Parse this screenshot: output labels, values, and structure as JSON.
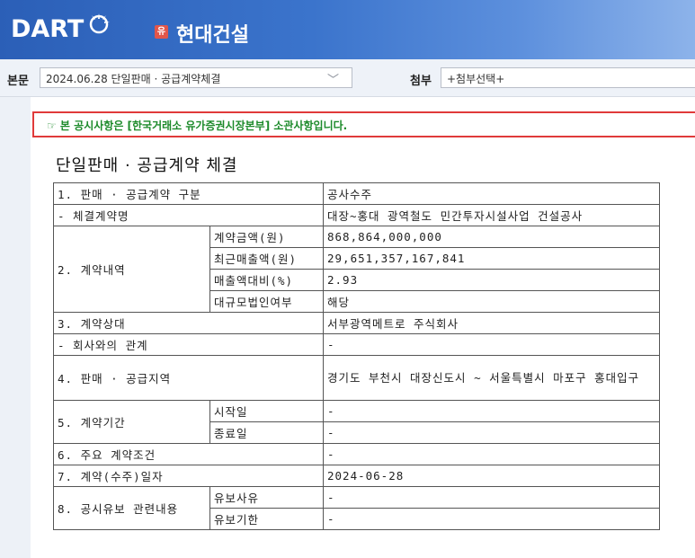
{
  "header": {
    "logo_text": "DART",
    "badge": "유",
    "company": "현대건설",
    "colors": {
      "header_start": "#2b5fb7",
      "header_end": "#8db3ea",
      "badge": "#e2564a"
    }
  },
  "toolbar": {
    "body_label": "본문",
    "report_select_value": "2024.06.28  단일판매 · 공급계약체결",
    "attach_label": "첨부",
    "attach_select_value": "+첨부선택+"
  },
  "notice": {
    "text": "☞ 본 공시사항은 [한국거래소 유가증권시장본부] 소관사항입니다.",
    "color": "#1c8a2a",
    "border_color": "#e03a3a"
  },
  "document": {
    "title": "단일판매 · 공급계약 체결",
    "rows": [
      {
        "label": "1. 판매 · 공급계약 구분",
        "value": "공사수주"
      },
      {
        "label": "- 체결계약명",
        "value": "대장~홍대 광역철도 민간투자시설사업 건설공사"
      },
      {
        "group": "2. 계약내역",
        "items": [
          {
            "label": "계약금액(원)",
            "value": "868,864,000,000"
          },
          {
            "label": "최근매출액(원)",
            "value": "29,651,357,167,841"
          },
          {
            "label": "매출액대비(%)",
            "value": "2.93"
          },
          {
            "label": "대규모법인여부",
            "value": "해당"
          }
        ]
      },
      {
        "label": "3. 계약상대",
        "value": "서부광역메트로 주식회사"
      },
      {
        "label": "- 회사와의 관계",
        "value": "-"
      },
      {
        "label": "4. 판매 · 공급지역",
        "value": "경기도 부천시 대장신도시 ~ 서울특별시 마포구 홍대입구"
      },
      {
        "group": "5. 계약기간",
        "items": [
          {
            "label": "시작일",
            "value": "-"
          },
          {
            "label": "종료일",
            "value": "-"
          }
        ]
      },
      {
        "label": "6. 주요 계약조건",
        "value": "-"
      },
      {
        "label": "7. 계약(수주)일자",
        "value": "2024-06-28"
      },
      {
        "group": "8. 공시유보 관련내용",
        "items": [
          {
            "label": "유보사유",
            "value": "-"
          },
          {
            "label": "유보기한",
            "value": "-"
          }
        ]
      }
    ]
  }
}
